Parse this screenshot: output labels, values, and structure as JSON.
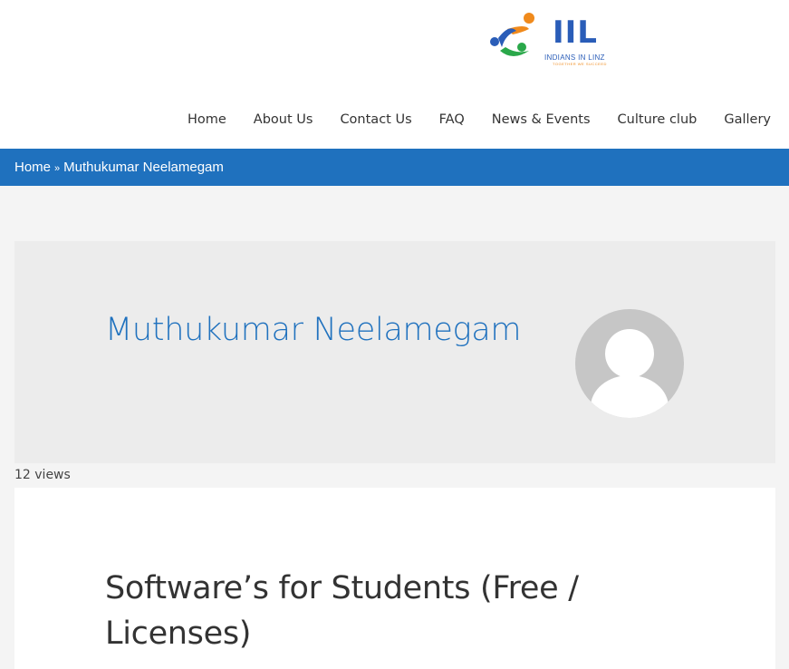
{
  "logo": {
    "text": "IIL",
    "subtitle": "INDIANS IN LINZ",
    "tagline": "TOGETHER WE SUCCEED",
    "colors": {
      "blue": "#2a5db8",
      "orange": "#f08a1c",
      "green": "#2aa84a"
    }
  },
  "nav": {
    "items": [
      {
        "label": "Home"
      },
      {
        "label": "About Us"
      },
      {
        "label": "Contact Us"
      },
      {
        "label": "FAQ"
      },
      {
        "label": "News & Events"
      },
      {
        "label": "Culture club"
      },
      {
        "label": "Gallery"
      }
    ]
  },
  "breadcrumb": {
    "home": "Home",
    "separator": "»",
    "current": "Muthukumar Neelamegam"
  },
  "profile": {
    "name": "Muthukumar Neelamegam",
    "avatar_icon": "default-user-avatar-icon",
    "views": "12 views"
  },
  "post": {
    "title": "Software’s for Students (Free / Licenses)"
  },
  "colors": {
    "accent": "#1f71be",
    "page_bg": "#f4f4f4",
    "card_bg": "#ececec"
  }
}
